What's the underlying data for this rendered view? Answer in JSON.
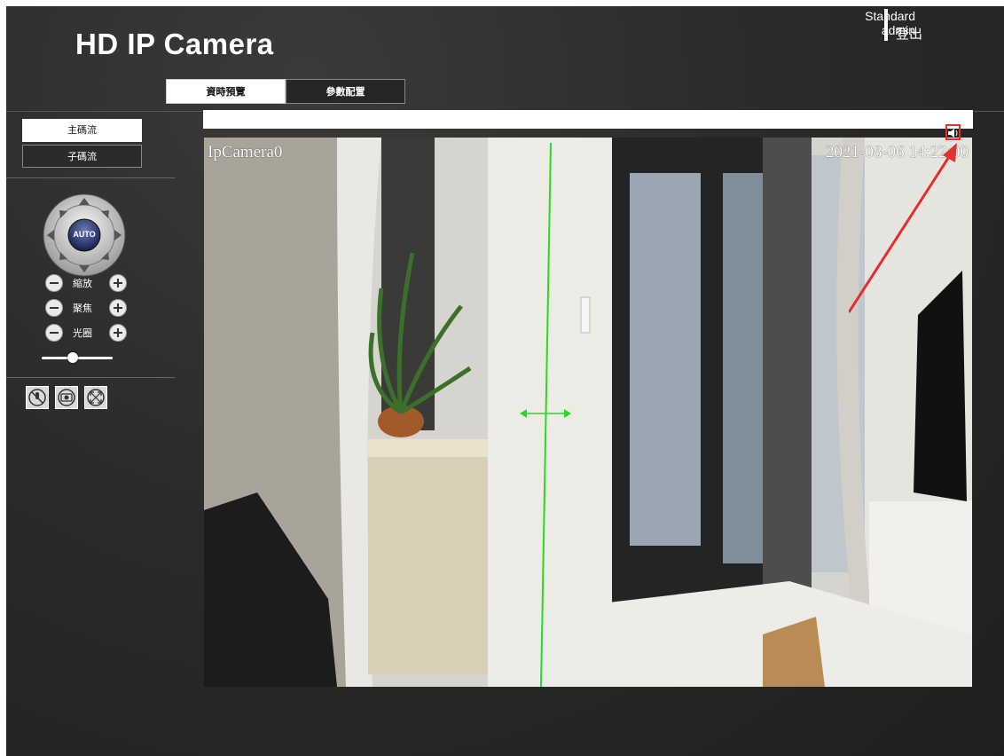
{
  "header": {
    "title": "HD IP Camera",
    "user_mode": "Standard",
    "username": "admin",
    "logout_label": "登出"
  },
  "tabs": [
    {
      "label": "資時預覽",
      "active": true
    },
    {
      "label": "參數配置",
      "active": false
    }
  ],
  "streams": [
    {
      "label": "主碼流",
      "active": true
    },
    {
      "label": "子碼流",
      "active": false
    }
  ],
  "ptz": {
    "center_label": "AUTO",
    "controls": [
      {
        "label": "縮放"
      },
      {
        "label": "聚焦"
      },
      {
        "label": "光圈"
      }
    ]
  },
  "tools": [
    {
      "icon": "mute-mic-icon"
    },
    {
      "icon": "snapshot-camera-icon"
    },
    {
      "icon": "fullscreen-icon"
    }
  ],
  "video": {
    "osd_name": "IpCamera0",
    "osd_time": "2021-08-06 14:22:00"
  },
  "colors": {
    "background": "#2b2b2b",
    "accent_green": "#22dd22",
    "annotation_red": "#e03030"
  }
}
